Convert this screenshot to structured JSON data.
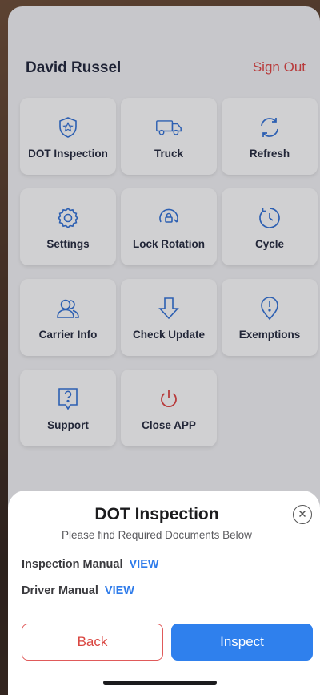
{
  "header": {
    "user_name": "David Russel",
    "sign_out": "Sign Out"
  },
  "tiles": [
    {
      "label": "DOT Inspection",
      "icon": "shield-star-icon"
    },
    {
      "label": "Truck",
      "icon": "truck-icon"
    },
    {
      "label": "Refresh",
      "icon": "refresh-icon"
    },
    {
      "label": "Settings",
      "icon": "gear-icon"
    },
    {
      "label": "Lock Rotation",
      "icon": "lock-rotation-icon"
    },
    {
      "label": "Cycle",
      "icon": "cycle-clock-icon"
    },
    {
      "label": "Carrier Info",
      "icon": "people-icon"
    },
    {
      "label": "Check Update",
      "icon": "arrow-down-icon"
    },
    {
      "label": "Exemptions",
      "icon": "exclamation-pin-icon"
    },
    {
      "label": "Support",
      "icon": "help-icon"
    },
    {
      "label": "Close APP",
      "icon": "power-icon"
    }
  ],
  "sheet": {
    "title": "DOT Inspection",
    "subtitle": "Please find Required Documents Below",
    "docs": [
      {
        "label": "Inspection Manual",
        "link": "VIEW"
      },
      {
        "label": "Driver Manual",
        "link": "VIEW"
      }
    ],
    "back_label": "Back",
    "inspect_label": "Inspect"
  },
  "colors": {
    "accent": "#2f80ed",
    "danger": "#e0413f",
    "icon": "#2e6fd6"
  }
}
